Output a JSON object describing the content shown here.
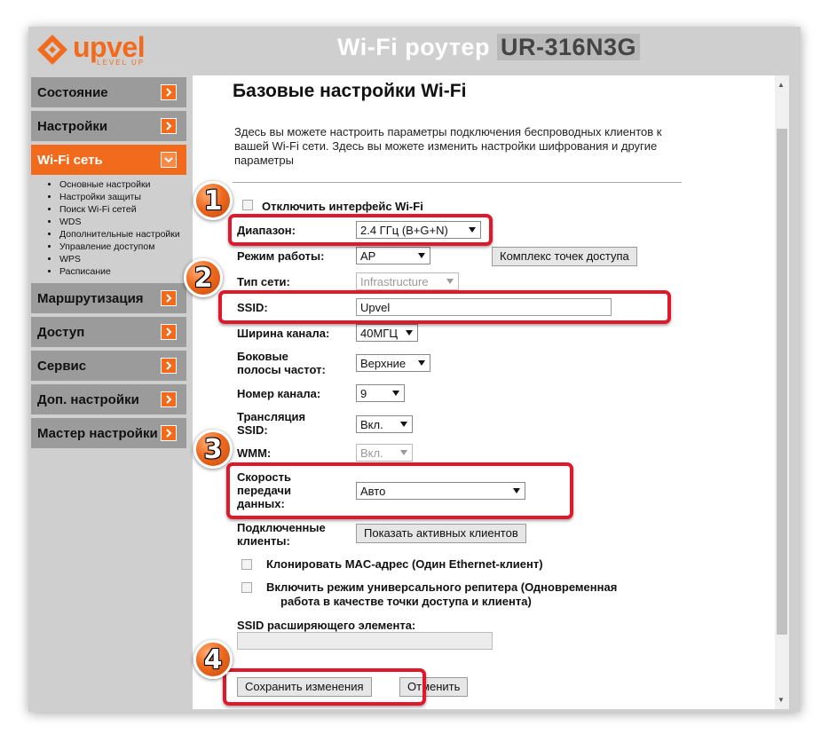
{
  "header": {
    "logo_word": "upvel",
    "logo_sub": "LEVEL UP",
    "title": "Wi-Fi роутер",
    "model": "UR-316N3G"
  },
  "sidebar": {
    "items": [
      {
        "label": "Состояние"
      },
      {
        "label": "Настройки"
      },
      {
        "label": "Wi-Fi сеть"
      },
      {
        "label": "Маршрутизация"
      },
      {
        "label": "Доступ"
      },
      {
        "label": "Сервис"
      },
      {
        "label": "Доп. настройки"
      },
      {
        "label": "Мастер настройки"
      }
    ],
    "submenu": [
      "Основные настройки",
      "Настройки защиты",
      "Поиск Wi-Fi сетей",
      "WDS",
      "Дополнительные настройки",
      "Управление доступом",
      "WPS",
      "Расписание"
    ]
  },
  "page": {
    "title": "Базовые настройки Wi-Fi",
    "description": "Здесь вы можете настроить параметры подключения беспроводных клиентов к вашей Wi-Fi сети. Здесь вы можете изменить настройки шифрования и другие параметры"
  },
  "form": {
    "disable_wifi_label": "Отключить интерфейс Wi-Fi",
    "band_label": "Диапазон:",
    "band_value": "2.4 ГГц (B+G+N)",
    "mode_label": "Режим работы:",
    "mode_value": "AP",
    "multi_ap_button": "Комплекс точек доступа",
    "network_type_label": "Тип сети:",
    "network_type_value": "Infrastructure",
    "ssid_label": "SSID:",
    "ssid_value": "Upvel",
    "channel_width_label": "Ширина канала:",
    "channel_width_value": "40МГЦ",
    "sideband_label_1": "Боковые",
    "sideband_label_2": "полосы частот:",
    "sideband_value": "Верхние",
    "channel_label": "Номер канала:",
    "channel_value": "9",
    "broadcast_label_1": "Трансляция",
    "broadcast_label_2": "SSID:",
    "broadcast_value": "Вкл.",
    "wmm_label": "WMM:",
    "wmm_value": "Вкл.",
    "rate_label_1": "Скорость",
    "rate_label_2": "передачи",
    "rate_label_3": "данных:",
    "rate_value": "Авто",
    "clients_label_1": "Подключенные",
    "clients_label_2": "клиенты:",
    "clients_button": "Показать активных клиентов",
    "clone_mac_label": "Клонировать MAC-адрес (Один Ethernet-клиент)",
    "repeater_label_1": "Включить режим универсального репитера (Одновременная",
    "repeater_label_2": "работа в качестве точки доступа и клиента)",
    "ext_ssid_label": "SSID расширяющего элемента:",
    "save_button": "Сохранить изменения",
    "cancel_button": "Отменить"
  },
  "badges": [
    "1",
    "2",
    "3",
    "4"
  ],
  "colors": {
    "accent": "#f26b1d",
    "highlight": "#e0182b",
    "menu_bg": "#9b9b9b",
    "frame_bg": "#cfcfcf"
  }
}
